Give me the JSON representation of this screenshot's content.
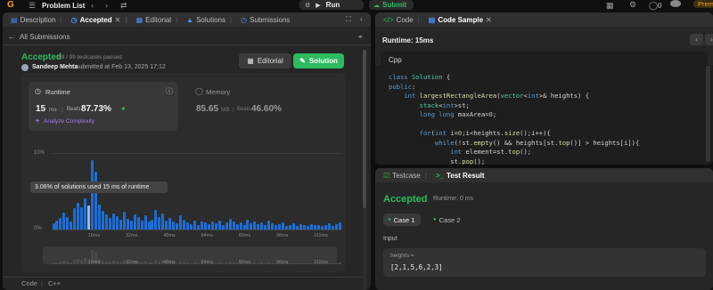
{
  "topbar": {
    "problem_list": "Problem List",
    "run": "Run",
    "submit": "Submit",
    "counter": "0",
    "premium": "Prem"
  },
  "left_tabs": [
    {
      "label": "Description"
    },
    {
      "label": "Accepted"
    },
    {
      "label": "Editorial"
    },
    {
      "label": "Solutions"
    },
    {
      "label": "Submissions"
    }
  ],
  "submissions": {
    "back": "All Submissions"
  },
  "result": {
    "status": "Accepted",
    "testcases": "99 / 99 testcases passed",
    "user": "Sandeep Mehta",
    "submitted": "submitted at Feb 13, 2025 17:12",
    "editorial_btn": "Editorial",
    "solution_btn": "Solution"
  },
  "runtime": {
    "label": "Runtime",
    "value": "15",
    "unit": "ms",
    "beats_label": "Beats",
    "beats": "87.73%",
    "analyze": "Analyze Complexity"
  },
  "memory": {
    "label": "Memory",
    "value": "85.65",
    "unit": "MB",
    "beats_label": "Beats",
    "beats": "46.60%"
  },
  "chart": {
    "y_top": "10%",
    "y_bottom": "0%",
    "x_ticks": [
      "16ms",
      "32ms",
      "48ms",
      "64ms",
      "80ms",
      "96ms",
      "111ms"
    ],
    "tooltip": "3.06% of solutions used 15 ms of runtime"
  },
  "chart_data": {
    "type": "bar",
    "title": "",
    "ylabel": "",
    "xlabel": "",
    "ylim": [
      0,
      10
    ],
    "highlight_ms": 15,
    "highlight_pct": 3.06,
    "x_ticks": [
      "16ms",
      "32ms",
      "48ms",
      "64ms",
      "80ms",
      "96ms",
      "111ms"
    ],
    "values": [
      0.8,
      1.2,
      1.5,
      2.2,
      1.6,
      1.0,
      2.8,
      3.4,
      2.9,
      4.0,
      3.06,
      9.0,
      7.5,
      3.2,
      2.4,
      1.9,
      1.5,
      2.1,
      1.7,
      1.3,
      2.3,
      1.4,
      1.1,
      2.0,
      1.6,
      1.2,
      1.8,
      1.0,
      1.3,
      2.5,
      1.6,
      2.1,
      1.2,
      1.5,
      1.0,
      0.8,
      1.8,
      1.3,
      0.9,
      0.7,
      1.2,
      0.6,
      1.0,
      0.9,
      0.7,
      1.0,
      0.8,
      1.1,
      0.6,
      0.9,
      1.4,
      1.0,
      0.7,
      0.9,
      0.6,
      1.3,
      0.8,
      1.0,
      0.7,
      0.9,
      0.6,
      1.2,
      0.8,
      0.6,
      0.7,
      0.9,
      0.5,
      0.6,
      0.8,
      0.5,
      0.7,
      0.6,
      0.5,
      0.7,
      0.6,
      0.6,
      0.5,
      0.6,
      0.8,
      0.5,
      0.7,
      0.9
    ]
  },
  "code_footer": {
    "label": "Code",
    "lang": "C++"
  },
  "right_tabs": [
    {
      "label": "Code"
    },
    {
      "label": "Code Sample"
    }
  ],
  "code_sample": {
    "runtime": "Runtime: 15ms",
    "lang": "Cpp",
    "lines": [
      "class Solution {",
      "public:",
      "    int largestRectangleArea(vector<int>& heights) {",
      "        stack<int>st;",
      "        long long maxArea=0;",
      "",
      "        for(int i=0;i<heights.size();i++){",
      "            while(!st.empty() && heights[st.top()] > heights[i]){",
      "                int element=st.top();",
      "                st.pop();"
    ]
  },
  "bottom_tabs": [
    {
      "label": "Testcase"
    },
    {
      "label": "Test Result"
    }
  ],
  "test_result": {
    "status": "Accepted",
    "runtime": "Runtime: 0 ms",
    "cases": [
      "Case 1",
      "Case 2"
    ],
    "input_label": "Input",
    "param": "heights =",
    "value": "[2,1,5,6,2,3]"
  }
}
